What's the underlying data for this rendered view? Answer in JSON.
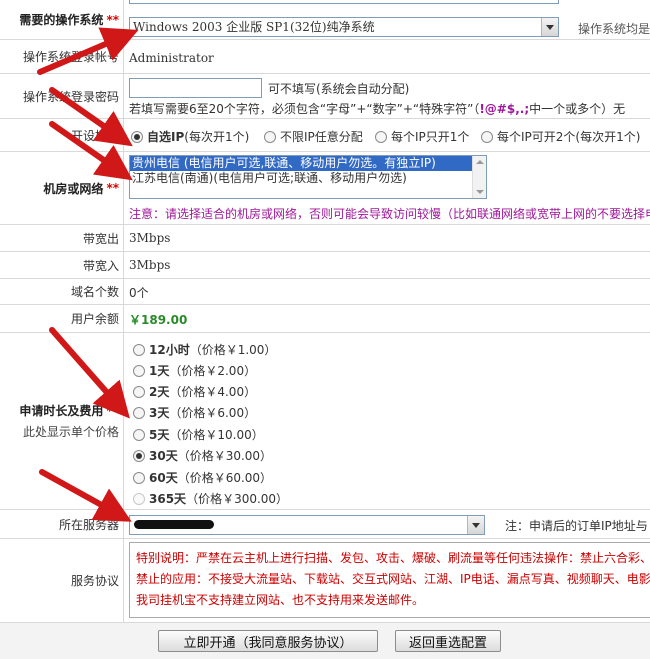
{
  "os": {
    "label": "需要的操作系统",
    "required_mark": "**",
    "selected": "Windows 2003 企业版 SP1(32位)纯净系统",
    "note": "操作系统均是"
  },
  "account": {
    "label": "操作系统登录帐号",
    "value": "Administrator"
  },
  "password": {
    "label": "操作系统登录密码",
    "hint1": "可不填写(系统会自动分配)",
    "hint2_prefix": "若填写需要6至20个字符，必须包含“字母”+“数字”+“特殊字符”（",
    "hint2_special": "!@#$,.;",
    "hint2_suffix": "中一个或多个）无"
  },
  "mode": {
    "label": "开设模式",
    "options": [
      {
        "text": "自选IP",
        "sub": "(每次开1个)",
        "checked": true
      },
      {
        "text": "不限IP任意分配",
        "sub": "",
        "checked": false
      },
      {
        "text": "每个IP只开1个",
        "sub": "",
        "checked": false
      },
      {
        "text": "每个IP可开2个",
        "sub": "(每次开1个)",
        "checked": false
      }
    ]
  },
  "room": {
    "label": "机房或网络",
    "required_mark": "**",
    "options": [
      {
        "text": "贵州电信 (电信用户可选,联通、移动用户勿选。有独立IP)",
        "selected": true
      },
      {
        "text": "江苏电信(南通)(电信用户可选;联通、移动用户勿选)",
        "selected": false
      }
    ],
    "notice": "注意：请选择适合的机房或网络，否则可能会导致访问较慢（比如联通网络或宽带上网的不要选择电"
  },
  "bandwidth_out": {
    "label": "带宽出",
    "value": "3Mbps"
  },
  "bandwidth_in": {
    "label": "带宽入",
    "value": "3Mbps"
  },
  "domains": {
    "label": "域名个数",
    "value": "0个"
  },
  "balance": {
    "label": "用户余额",
    "value": "￥189.00"
  },
  "duration": {
    "label": "申请时长及费用",
    "required_mark": "**",
    "sub_label": "此处显示单个价格",
    "options": [
      {
        "period": "12小时",
        "price": "（价格￥1.00）",
        "checked": false,
        "disabled": false
      },
      {
        "period": "1天",
        "price": "（价格￥2.00）",
        "checked": false,
        "disabled": false
      },
      {
        "period": "2天",
        "price": "（价格￥4.00）",
        "checked": false,
        "disabled": false
      },
      {
        "period": "3天",
        "price": "（价格￥6.00）",
        "checked": false,
        "disabled": false
      },
      {
        "period": "5天",
        "price": "（价格￥10.00）",
        "checked": false,
        "disabled": false
      },
      {
        "period": "30天",
        "price": "（价格￥30.00）",
        "checked": true,
        "disabled": false
      },
      {
        "period": "60天",
        "price": "（价格￥60.00）",
        "checked": false,
        "disabled": false
      },
      {
        "period": "365天",
        "price": "（价格￥300.00）",
        "checked": false,
        "disabled": true
      }
    ]
  },
  "server": {
    "label": "所在服务器",
    "selected": "",
    "note": "注：申请后的订单IP地址与"
  },
  "agreement": {
    "label": "服务协议",
    "line1": "特别说明：严禁在云主机上进行扫描、发包、攻击、爆破、刷流量等任何违法操作：禁止六合彩、",
    "line2": "禁止的应用：不接受大流量站、下载站、交互式网站、江湖、IP电话、漏点写真、视频聊天、电影",
    "line3": "我司挂机宝不支持建立网站、也不支持用来发送邮件。"
  },
  "actions": {
    "submit": "立即开通（我同意服务协议）",
    "back": "返回重选配置"
  },
  "colors": {
    "required": "#cc0000",
    "balance": "#2a8a2a",
    "notice": "#a0179b",
    "agreement": "#cc0000",
    "arrow": "#d01818"
  }
}
